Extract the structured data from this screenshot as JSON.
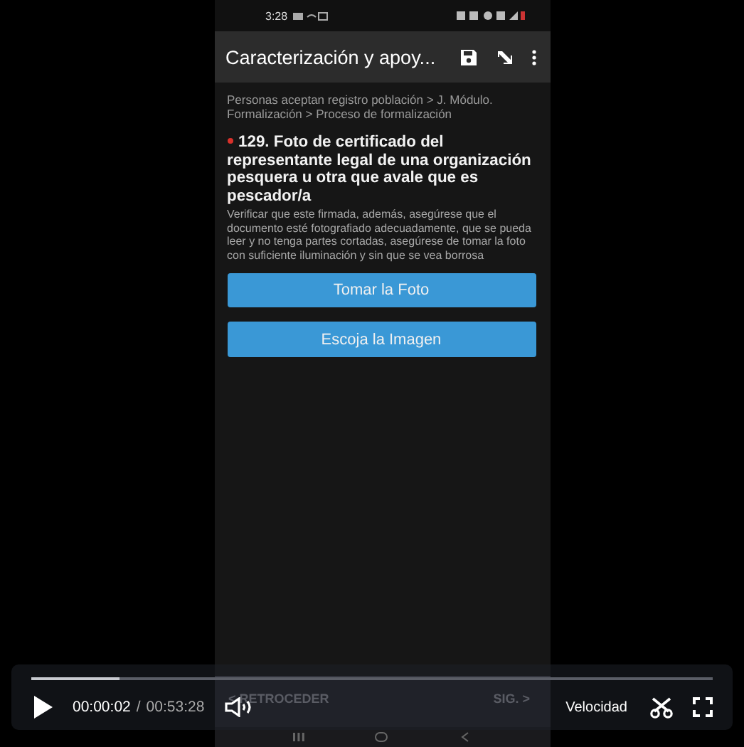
{
  "phone": {
    "status_bar": {
      "time": "3:28"
    },
    "app_bar": {
      "title": "Caracterización y apoy..."
    },
    "breadcrumb": "Personas aceptan registro población > J. Módulo. Formalización > Proceso de formalización",
    "question": {
      "required": true,
      "title": "129. Foto de certificado del representante legal de una organización pesquera u otra que avale que es pescador/a",
      "hint": "Verificar que este firmada, además, asegúrese que el documento esté fotografiado adecuadamente, que se pueda leer y no tenga partes cortadas, asegúrese de tomar la foto con suficiente iluminación y sin que se vea borrosa"
    },
    "buttons": [
      "Tomar la Foto",
      "Escoja la Imagen"
    ],
    "nav": {
      "back": "< RETROCEDER",
      "next": "SIG. >"
    }
  },
  "player": {
    "level": 0.13,
    "current_time": "00:00:02",
    "separator": "/",
    "duration": "00:53:28",
    "speed_label": "Velocidad"
  }
}
